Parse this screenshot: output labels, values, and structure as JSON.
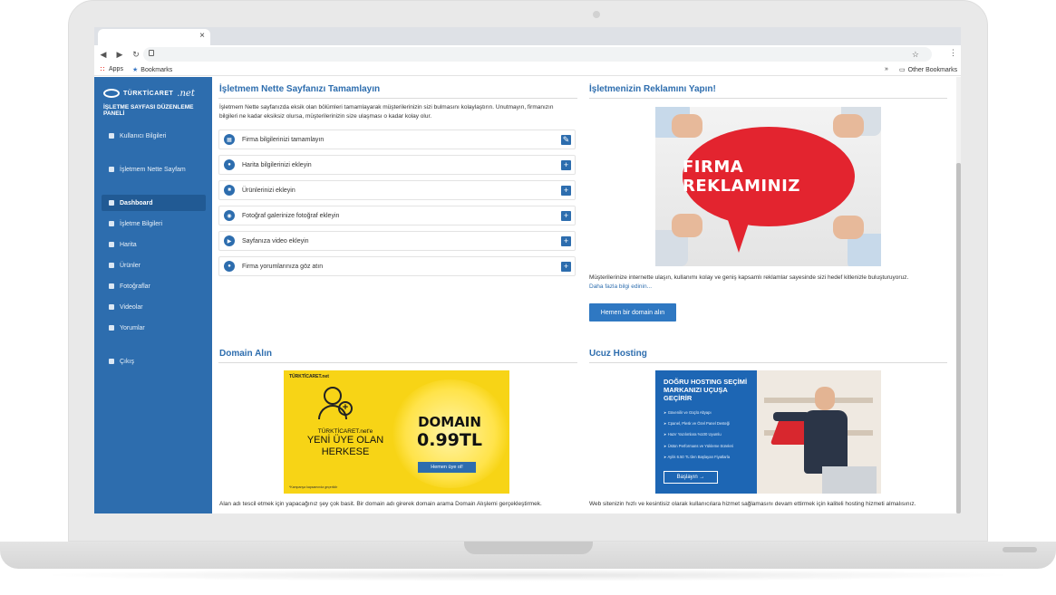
{
  "browser": {
    "tab_close": "×",
    "bookmarks": {
      "apps": "Apps",
      "bookmarks": "Bookmarks",
      "overflow": "»",
      "other": "Other Bookmarks"
    }
  },
  "sidebar": {
    "logo_text": "TÜRKTİCARET",
    "logo_net": ".net",
    "panel_title": "İŞLETME SAYFASI DÜZENLEME PANELİ",
    "items": [
      {
        "label": "Kullanıcı Bilgileri",
        "icon": "user-icon"
      },
      {
        "label": "İşletmem Nette Sayfam",
        "icon": "external-link-icon"
      },
      {
        "label": "Dashboard",
        "icon": "dashboard-icon",
        "active": true
      },
      {
        "label": "İşletme Bilgileri",
        "icon": "info-card-icon"
      },
      {
        "label": "Harita",
        "icon": "map-pin-icon"
      },
      {
        "label": "Ürünler",
        "icon": "box-icon"
      },
      {
        "label": "Fotoğraflar",
        "icon": "image-icon"
      },
      {
        "label": "Videolar",
        "icon": "video-icon"
      },
      {
        "label": "Yorumlar",
        "icon": "comment-icon"
      },
      {
        "label": "Çıkış",
        "icon": "logout-icon"
      }
    ]
  },
  "complete_page": {
    "title": "İşletmem Nette Sayfanızı Tamamlayın",
    "description": "İşletmem Nette sayfanızda eksik olan bölümleri tamamlayarak müşterilerinizin sizi bulmasını kolaylaştırın. Unutmayın, firmanızın bilgileri ne kadar eksiksiz olursa, müşterilerinizin size ulaşması o kadar kolay olur.",
    "tasks": [
      {
        "label": "Firma bilgilerinizi tamamlayın",
        "icon": "company-icon",
        "button": "✎"
      },
      {
        "label": "Harita bilgilerinizi ekleyin",
        "icon": "map-pin-icon",
        "button": "+"
      },
      {
        "label": "Ürünlerinizi ekleyin",
        "icon": "box-icon",
        "button": "+"
      },
      {
        "label": "Fotoğraf galerinize fotoğraf ekleyin",
        "icon": "camera-icon",
        "button": "+"
      },
      {
        "label": "Sayfanıza video ekleyin",
        "icon": "video-icon",
        "button": "+"
      },
      {
        "label": "Firma yorumlarınıza göz atın",
        "icon": "comment-icon",
        "button": "+"
      }
    ]
  },
  "advertise": {
    "title": "İşletmenizin Reklamını Yapın!",
    "image_text": "FIRMA REKLAMINIZ",
    "description": "Müşterilerinize internette ulaşın, kullanımı kolay ve geniş kapsamlı reklamlar sayesinde sizi hedef kitlenizle buluşturuyoruz.",
    "more_link": "Daha fazla bilgi edinin...",
    "button": "Hemen bir domain alın"
  },
  "domain": {
    "title": "Domain Alın",
    "banner_logo": "TÜRKTİCARET.net",
    "banner_line1": "TÜRKTİCARET.net'e",
    "banner_line2": "YENİ ÜYE OLAN",
    "banner_line3": "HERKESE",
    "banner_price1": "DOMAIN",
    "banner_price2": "0.99TL",
    "banner_button": "Hemen üye ol!",
    "banner_small": "*Kampanya kapsamında geçerlidir",
    "description": "Alan adı tescil etmek için yapacağınız şey çok basit. Bir domain adı girerek domain arama Domain Alışlemi gerçekleştirmek."
  },
  "hosting": {
    "title": "Ucuz Hosting",
    "banner_title": "DOĞRU HOSTING SEÇİMİ MARKANIZI UÇUŞA GEÇİRİR",
    "features": [
      "Güvenilir ve Güçlü Altyapı",
      "Cpanel, Plesk ve Özel Panel Desteği",
      "Hazır Yazılımlara %100 Uyumlu",
      "Üstün Performans ve Yükleme Süreleri",
      "Aylık 6.50 TL'den Başlayan Fiyatlarla"
    ],
    "banner_button": "Başlayın →",
    "description": "Web sitenizin hızlı ve kesintisiz olarak kullanıcılara hizmet sağlamasını devam ettirmek için kaliteli hosting hizmeti almalısınız."
  },
  "colors": {
    "sidebar": "#2d6dae",
    "accent": "#2d6dae",
    "ad_bubble": "#e3242f",
    "domain_banner": "#f7d416",
    "hosting_banner": "#1d66b4"
  }
}
